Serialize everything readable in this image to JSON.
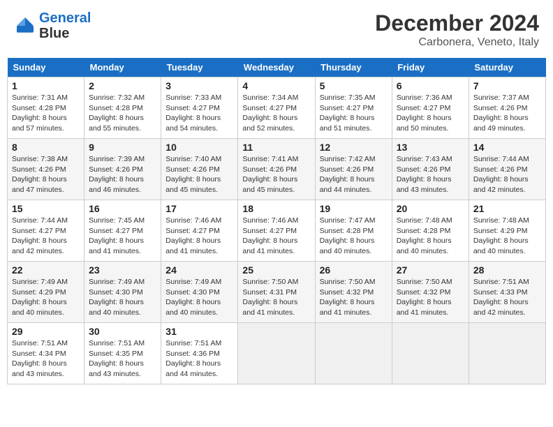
{
  "header": {
    "logo_line1": "General",
    "logo_line2": "Blue",
    "month_title": "December 2024",
    "subtitle": "Carbonera, Veneto, Italy"
  },
  "weekdays": [
    "Sunday",
    "Monday",
    "Tuesday",
    "Wednesday",
    "Thursday",
    "Friday",
    "Saturday"
  ],
  "weeks": [
    [
      {
        "day": "1",
        "info": "Sunrise: 7:31 AM\nSunset: 4:28 PM\nDaylight: 8 hours\nand 57 minutes."
      },
      {
        "day": "2",
        "info": "Sunrise: 7:32 AM\nSunset: 4:28 PM\nDaylight: 8 hours\nand 55 minutes."
      },
      {
        "day": "3",
        "info": "Sunrise: 7:33 AM\nSunset: 4:27 PM\nDaylight: 8 hours\nand 54 minutes."
      },
      {
        "day": "4",
        "info": "Sunrise: 7:34 AM\nSunset: 4:27 PM\nDaylight: 8 hours\nand 52 minutes."
      },
      {
        "day": "5",
        "info": "Sunrise: 7:35 AM\nSunset: 4:27 PM\nDaylight: 8 hours\nand 51 minutes."
      },
      {
        "day": "6",
        "info": "Sunrise: 7:36 AM\nSunset: 4:27 PM\nDaylight: 8 hours\nand 50 minutes."
      },
      {
        "day": "7",
        "info": "Sunrise: 7:37 AM\nSunset: 4:26 PM\nDaylight: 8 hours\nand 49 minutes."
      }
    ],
    [
      {
        "day": "8",
        "info": "Sunrise: 7:38 AM\nSunset: 4:26 PM\nDaylight: 8 hours\nand 47 minutes."
      },
      {
        "day": "9",
        "info": "Sunrise: 7:39 AM\nSunset: 4:26 PM\nDaylight: 8 hours\nand 46 minutes."
      },
      {
        "day": "10",
        "info": "Sunrise: 7:40 AM\nSunset: 4:26 PM\nDaylight: 8 hours\nand 45 minutes."
      },
      {
        "day": "11",
        "info": "Sunrise: 7:41 AM\nSunset: 4:26 PM\nDaylight: 8 hours\nand 45 minutes."
      },
      {
        "day": "12",
        "info": "Sunrise: 7:42 AM\nSunset: 4:26 PM\nDaylight: 8 hours\nand 44 minutes."
      },
      {
        "day": "13",
        "info": "Sunrise: 7:43 AM\nSunset: 4:26 PM\nDaylight: 8 hours\nand 43 minutes."
      },
      {
        "day": "14",
        "info": "Sunrise: 7:44 AM\nSunset: 4:26 PM\nDaylight: 8 hours\nand 42 minutes."
      }
    ],
    [
      {
        "day": "15",
        "info": "Sunrise: 7:44 AM\nSunset: 4:27 PM\nDaylight: 8 hours\nand 42 minutes."
      },
      {
        "day": "16",
        "info": "Sunrise: 7:45 AM\nSunset: 4:27 PM\nDaylight: 8 hours\nand 41 minutes."
      },
      {
        "day": "17",
        "info": "Sunrise: 7:46 AM\nSunset: 4:27 PM\nDaylight: 8 hours\nand 41 minutes."
      },
      {
        "day": "18",
        "info": "Sunrise: 7:46 AM\nSunset: 4:27 PM\nDaylight: 8 hours\nand 41 minutes."
      },
      {
        "day": "19",
        "info": "Sunrise: 7:47 AM\nSunset: 4:28 PM\nDaylight: 8 hours\nand 40 minutes."
      },
      {
        "day": "20",
        "info": "Sunrise: 7:48 AM\nSunset: 4:28 PM\nDaylight: 8 hours\nand 40 minutes."
      },
      {
        "day": "21",
        "info": "Sunrise: 7:48 AM\nSunset: 4:29 PM\nDaylight: 8 hours\nand 40 minutes."
      }
    ],
    [
      {
        "day": "22",
        "info": "Sunrise: 7:49 AM\nSunset: 4:29 PM\nDaylight: 8 hours\nand 40 minutes."
      },
      {
        "day": "23",
        "info": "Sunrise: 7:49 AM\nSunset: 4:30 PM\nDaylight: 8 hours\nand 40 minutes."
      },
      {
        "day": "24",
        "info": "Sunrise: 7:49 AM\nSunset: 4:30 PM\nDaylight: 8 hours\nand 40 minutes."
      },
      {
        "day": "25",
        "info": "Sunrise: 7:50 AM\nSunset: 4:31 PM\nDaylight: 8 hours\nand 41 minutes."
      },
      {
        "day": "26",
        "info": "Sunrise: 7:50 AM\nSunset: 4:32 PM\nDaylight: 8 hours\nand 41 minutes."
      },
      {
        "day": "27",
        "info": "Sunrise: 7:50 AM\nSunset: 4:32 PM\nDaylight: 8 hours\nand 41 minutes."
      },
      {
        "day": "28",
        "info": "Sunrise: 7:51 AM\nSunset: 4:33 PM\nDaylight: 8 hours\nand 42 minutes."
      }
    ],
    [
      {
        "day": "29",
        "info": "Sunrise: 7:51 AM\nSunset: 4:34 PM\nDaylight: 8 hours\nand 43 minutes."
      },
      {
        "day": "30",
        "info": "Sunrise: 7:51 AM\nSunset: 4:35 PM\nDaylight: 8 hours\nand 43 minutes."
      },
      {
        "day": "31",
        "info": "Sunrise: 7:51 AM\nSunset: 4:36 PM\nDaylight: 8 hours\nand 44 minutes."
      },
      {
        "day": "",
        "info": ""
      },
      {
        "day": "",
        "info": ""
      },
      {
        "day": "",
        "info": ""
      },
      {
        "day": "",
        "info": ""
      }
    ]
  ]
}
